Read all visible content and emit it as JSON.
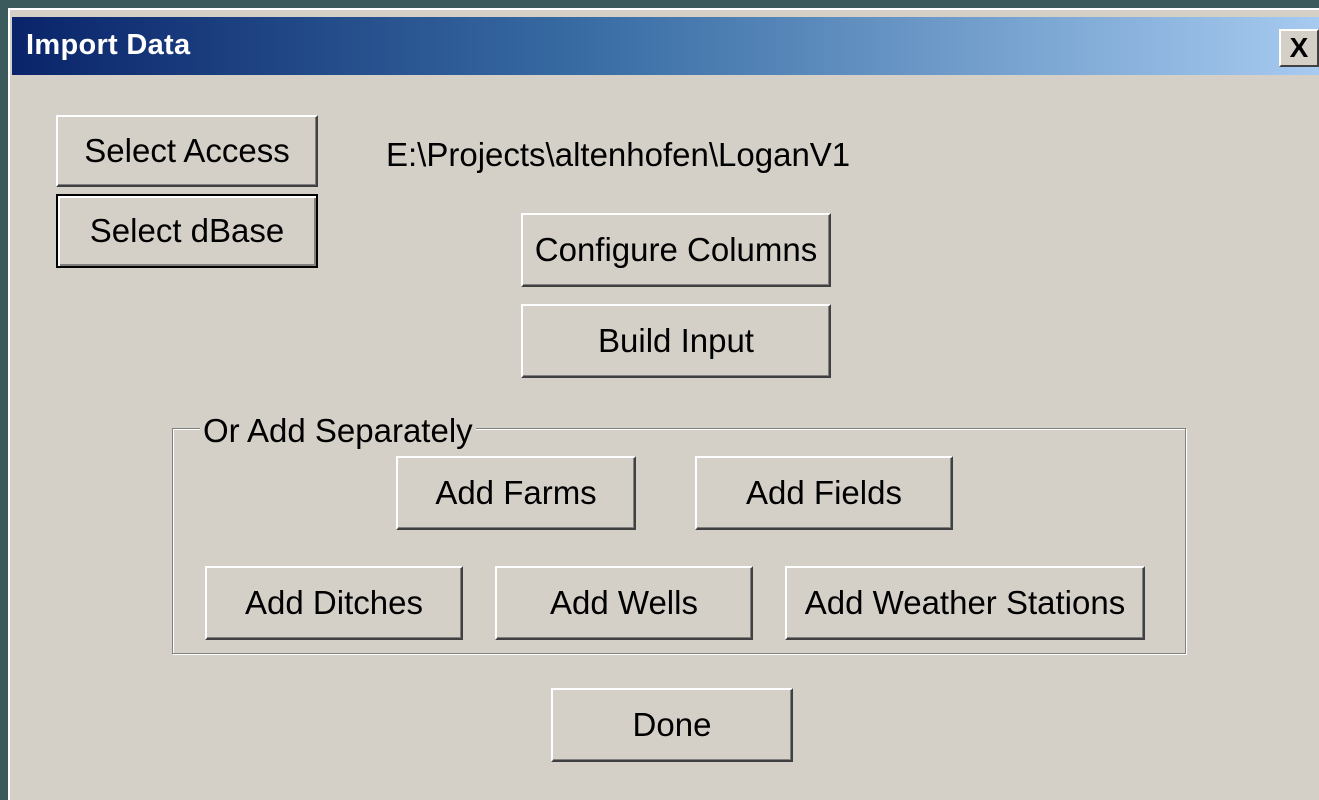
{
  "window": {
    "title": "Import Data",
    "close_label": "X"
  },
  "buttons": {
    "select_access": "Select Access",
    "select_dbase": "Select dBase",
    "configure_columns": "Configure Columns",
    "build_input": "Build Input",
    "add_farms": "Add Farms",
    "add_fields": "Add Fields",
    "add_ditches": "Add Ditches",
    "add_wells": "Add Wells",
    "add_weather_stations": "Add Weather Stations",
    "done": "Done"
  },
  "path": "E:\\Projects\\altenhofen\\LoganV1",
  "group": {
    "label": "Or Add Separately"
  }
}
